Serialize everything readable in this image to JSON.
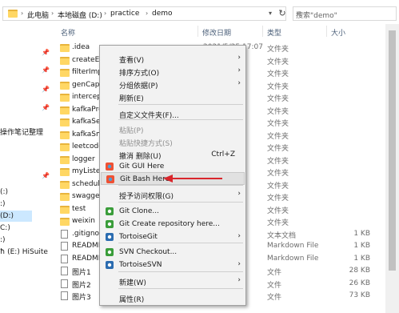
{
  "address": {
    "crumbs": [
      "此电脑",
      "本地磁盘 (D:)",
      "practice",
      "demo"
    ],
    "separator": "›"
  },
  "search": {
    "placeholder": "搜索\"demo\""
  },
  "nav": {
    "texts": [
      "操作笔记整理",
      "(:)",
      ":)",
      "(D:)",
      "C:)",
      ":)",
      "ħ (E:) HiSuite"
    ]
  },
  "columns": {
    "name": "名称",
    "date": "修改日期",
    "type": "类型",
    "size": "大小"
  },
  "files": [
    {
      "name": ".idea",
      "date": "2021/5/25 17:07",
      "type": "文件夹",
      "size": "",
      "icon": "folder-icon"
    },
    {
      "name": "createExc",
      "date": "",
      "type": "文件夹",
      "size": "",
      "icon": "folder-icon"
    },
    {
      "name": "filterImpl",
      "date": "",
      "type": "文件夹",
      "size": "",
      "icon": "folder-icon"
    },
    {
      "name": "genCaptc",
      "date": "",
      "type": "文件夹",
      "size": "",
      "icon": "folder-icon"
    },
    {
      "name": "intercept",
      "date": "",
      "type": "文件夹",
      "size": "",
      "icon": "folder-icon"
    },
    {
      "name": "kafkaPro",
      "date": "",
      "type": "文件夹",
      "size": "",
      "icon": "folder-icon"
    },
    {
      "name": "kafkaSer",
      "date": "",
      "type": "文件夹",
      "size": "",
      "icon": "folder-icon"
    },
    {
      "name": "kafkaSm",
      "date": "",
      "type": "文件夹",
      "size": "",
      "icon": "folder-icon"
    },
    {
      "name": "leetcode",
      "date": "2",
      "type": "文件夹",
      "size": "",
      "icon": "folder-icon"
    },
    {
      "name": "logger",
      "date": "",
      "type": "文件夹",
      "size": "",
      "icon": "folder-icon"
    },
    {
      "name": "myListen",
      "date": "",
      "type": "文件夹",
      "size": "",
      "icon": "folder-icon"
    },
    {
      "name": "schedule",
      "date": "",
      "type": "文件夹",
      "size": "",
      "icon": "folder-icon"
    },
    {
      "name": "swagger",
      "date": "",
      "type": "文件夹",
      "size": "",
      "icon": "folder-icon"
    },
    {
      "name": "test",
      "date": "",
      "type": "文件夹",
      "size": "",
      "icon": "folder-icon"
    },
    {
      "name": "weixin",
      "date": "",
      "type": "文件夹",
      "size": "",
      "icon": "folder-icon"
    },
    {
      "name": ".gitignor",
      "date": "9",
      "type": "文本文档",
      "size": "1 KB",
      "icon": "document-icon"
    },
    {
      "name": "README",
      "date": "",
      "type": "Markdown File",
      "size": "1 KB",
      "icon": "document-icon"
    },
    {
      "name": "README",
      "date": "",
      "type": "Markdown File",
      "size": "1 KB",
      "icon": "document-icon"
    },
    {
      "name": "图片1",
      "date": "",
      "type": "文件",
      "size": "28 KB",
      "icon": "image-icon"
    },
    {
      "name": "图片2",
      "date": "",
      "type": "文件",
      "size": "26 KB",
      "icon": "image-icon"
    },
    {
      "name": "图片3",
      "date": "",
      "type": "文件",
      "size": "73 KB",
      "icon": "image-icon"
    }
  ],
  "context_menu": {
    "items": [
      {
        "label": "查看(V)",
        "shortcut": "",
        "arrow": "›",
        "disabled": false,
        "icon": ""
      },
      {
        "label": "排序方式(O)",
        "shortcut": "",
        "arrow": "›",
        "disabled": false,
        "icon": ""
      },
      {
        "label": "分组依据(P)",
        "shortcut": "",
        "arrow": "›",
        "disabled": false,
        "icon": ""
      },
      {
        "label": "刷新(E)",
        "shortcut": "",
        "arrow": "",
        "disabled": false,
        "icon": ""
      },
      {
        "label": "自定义文件夹(F)...",
        "shortcut": "",
        "arrow": "",
        "disabled": false,
        "icon": ""
      },
      {
        "label": "粘贴(P)",
        "shortcut": "",
        "arrow": "",
        "disabled": true,
        "icon": ""
      },
      {
        "label": "粘贴快捷方式(S)",
        "shortcut": "",
        "arrow": "",
        "disabled": true,
        "icon": ""
      },
      {
        "label": "撤消 删除(U)",
        "shortcut": "Ctrl+Z",
        "arrow": "",
        "disabled": false,
        "icon": ""
      },
      {
        "label": "Git GUI Here",
        "shortcut": "",
        "arrow": "",
        "disabled": false,
        "icon": "git-gui-icon"
      },
      {
        "label": "Git Bash Here",
        "shortcut": "",
        "arrow": "",
        "disabled": false,
        "icon": "git-bash-icon"
      },
      {
        "label": "授予访问权限(G)",
        "shortcut": "",
        "arrow": "›",
        "disabled": false,
        "icon": ""
      },
      {
        "label": "Git Clone...",
        "shortcut": "",
        "arrow": "",
        "disabled": false,
        "icon": "tortoisegit-clone-icon"
      },
      {
        "label": "Git Create repository here...",
        "shortcut": "",
        "arrow": "",
        "disabled": false,
        "icon": "tortoisegit-create-icon"
      },
      {
        "label": "TortoiseGit",
        "shortcut": "",
        "arrow": "›",
        "disabled": false,
        "icon": "tortoisegit-icon"
      },
      {
        "label": "SVN Checkout...",
        "shortcut": "",
        "arrow": "",
        "disabled": false,
        "icon": "svn-checkout-icon"
      },
      {
        "label": "TortoiseSVN",
        "shortcut": "",
        "arrow": "›",
        "disabled": false,
        "icon": "tortoisesvn-icon"
      },
      {
        "label": "新建(W)",
        "shortcut": "",
        "arrow": "›",
        "disabled": false,
        "icon": ""
      },
      {
        "label": "属性(R)",
        "shortcut": "",
        "arrow": "",
        "disabled": false,
        "icon": ""
      }
    ]
  },
  "colors": {
    "folder": "#ffd764",
    "selection": "#cce8ff",
    "annotation_arrow": "#d9262c"
  }
}
